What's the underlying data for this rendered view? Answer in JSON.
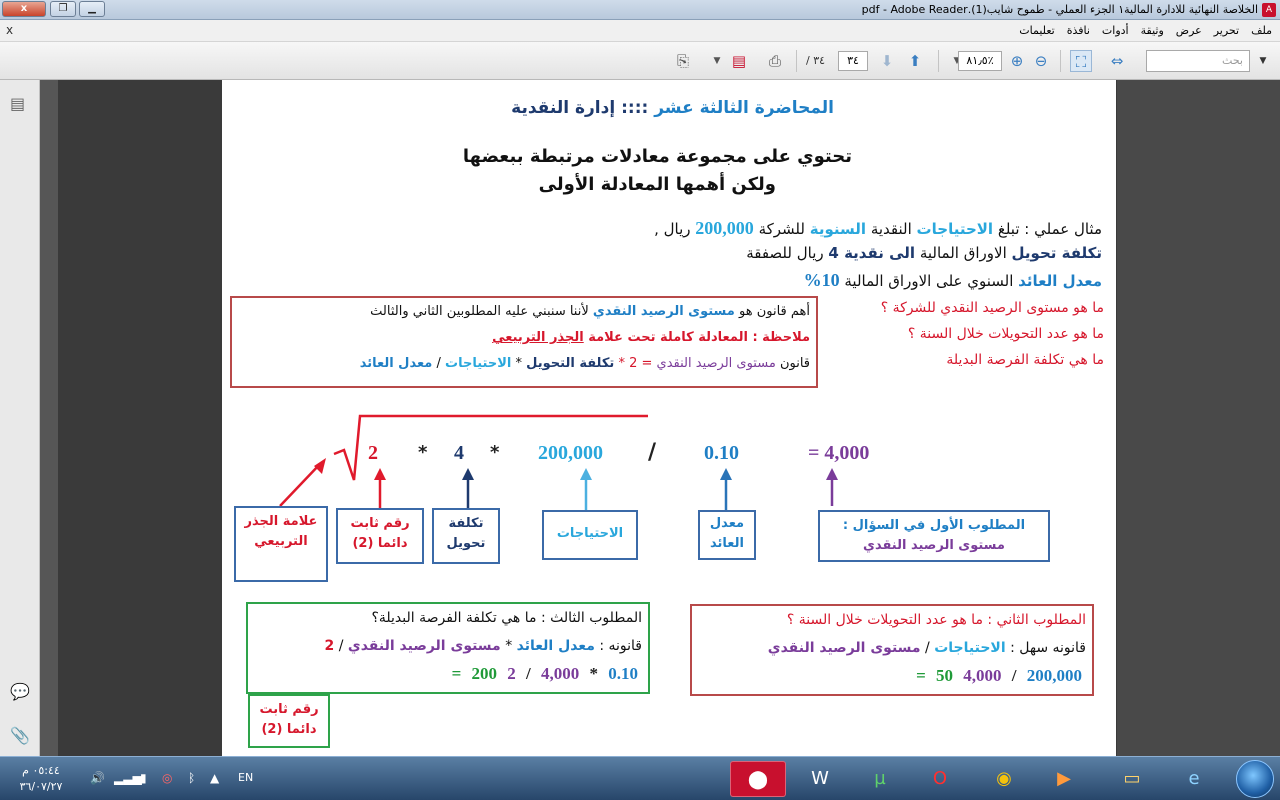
{
  "window": {
    "title": "الخلاصة النهائية للادارة المالية١ الجزء العملي - طموح شايب(1).pdf - Adobe Reader",
    "close_label": "x"
  },
  "menu": {
    "items": [
      "ملف",
      "تحرير",
      "عرض",
      "وثيقة",
      "أدوات",
      "نافذة",
      "تعليمات"
    ],
    "close_label": "x"
  },
  "toolbar": {
    "search_placeholder": "بحث",
    "zoom": "٨١٫٥٪",
    "current_page": "٣٤",
    "total_pages": "/ ٣٤"
  },
  "doc": {
    "heading_lecture": "المحاضرة الثالثة عشر",
    "heading_sep": "::::",
    "heading_topic": "إدارة النقدية",
    "intro_line1": "تحتوي على مجموعة معادلات مرتبطة ببعضها",
    "intro_line2": "ولكن أهمها المعادلة الأولى",
    "example": {
      "l1_a": "مثال عملي : تبلغ",
      "l1_b": "الاحتياجات",
      "l1_c": "النقدية",
      "l1_d": "السنوية",
      "l1_e": "للشركة",
      "l1_f": "200,000",
      "l1_g": "ريال ,",
      "l2_a": "تكلفة تحويل",
      "l2_b": "الاوراق المالية",
      "l2_c": "الى نقدية 4",
      "l2_d": "ريال للصفقة",
      "l3_a": "معدل العائد",
      "l3_b": "السنوي على الاوراق المالية",
      "l3_c": "10%"
    },
    "questions": [
      "ما هو مستوى الرصيد النقدي للشركة ؟",
      "ما هو عدد التحويلات خلال السنة ؟",
      "ما هي تكلفة الفرصة البديلة"
    ],
    "law_box": {
      "l1_a": "أهم قانون هو",
      "l1_b": "مستوى الرصيد النقدي",
      "l1_c": "لأننا سنبني عليه المطلوبين الثاني والثالث",
      "l2_a": "ملاحظة : المعادلة كاملة تحت علامة",
      "l2_b": "الجذر التربيعي",
      "l3_a": "قانون",
      "l3_b": "مستوى الرصيد النقدي",
      "l3_c": "= 2 *",
      "l3_d": "تكلفة التحويل",
      "l3_e": "*",
      "l3_f": "الاحتياجات",
      "l3_g": "/",
      "l3_h": "معدل العائد"
    },
    "equation": {
      "two": "2",
      "star1": "*",
      "four": "4",
      "star2": "*",
      "needs": "200,000",
      "slash": "/",
      "rate": "0.10",
      "result": "= 4,000"
    },
    "labels": {
      "root": "علامة الجذر التربيعي",
      "constant": "رقم ثابت دائما (2)",
      "cost": "تكلفة تحويل",
      "needs": "الاحتياجات",
      "rate": "معدل العائد",
      "first_a": "المطلوب الأول في السؤال :",
      "first_b": "مستوى الرصيد النقدي"
    },
    "third": {
      "title": "المطلوب الثالث : ما هي تكلفة الفرصة البديلة؟",
      "law_a": "قانونه :",
      "law_b": "معدل العائد",
      "law_c": "*",
      "law_d": "مستوى الرصيد النقدي",
      "law_e": "/",
      "law_f": "2",
      "calc_rate": "0.10",
      "calc_star": "*",
      "calc_bal": "4,000",
      "calc_slash": "/",
      "calc_two": "2",
      "calc_eq": "= 200",
      "const_label": "رقم ثابت دائما (2)"
    },
    "second": {
      "title": "المطلوب الثاني : ما هو عدد التحويلات خلال السنة ؟",
      "law_a": "قانونه سهل :",
      "law_b": "الاحتياجات",
      "law_c": "/",
      "law_d": "مستوى الرصيد النقدي",
      "calc_needs": "200,000",
      "calc_slash": "/",
      "calc_bal": "4,000",
      "calc_eq": "= 50"
    }
  },
  "taskbar": {
    "time": "٠٥:٤٤ م",
    "date": "٣٦/٠٧/٢٧",
    "lang": "EN"
  },
  "colors": {
    "red": "#d6172c",
    "blue": "#1f7fc5",
    "cyan": "#29a7dc",
    "navy": "#1e3a6e",
    "purple": "#7a3c9a",
    "green": "#1f9a38"
  }
}
